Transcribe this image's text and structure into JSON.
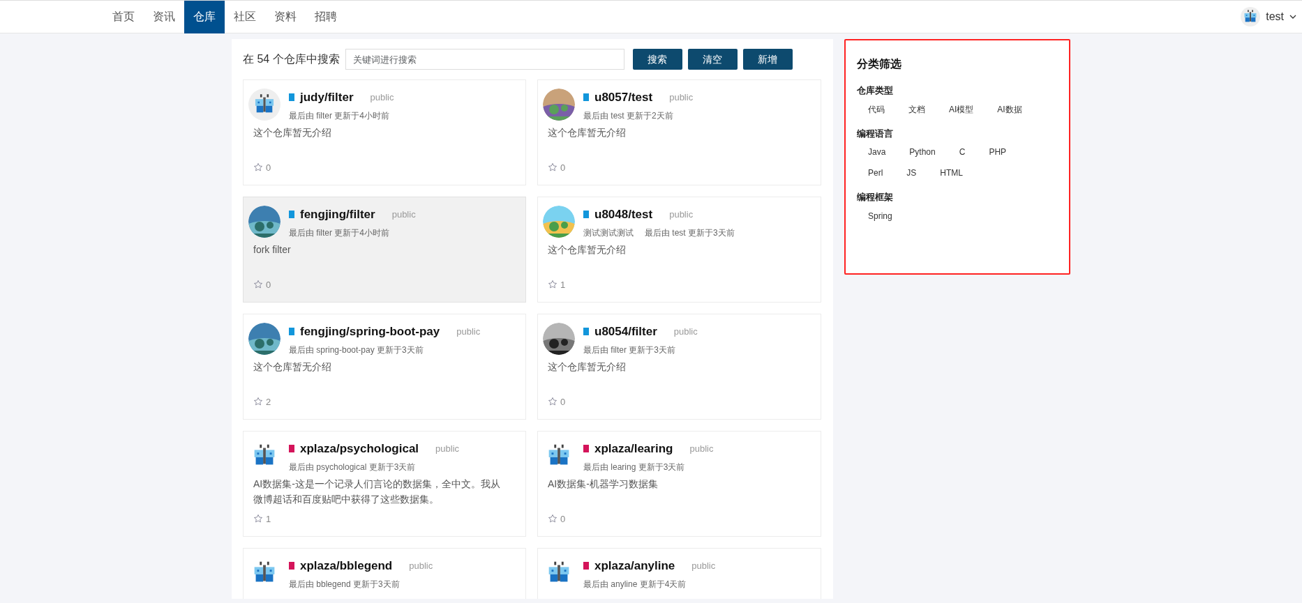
{
  "nav": {
    "items": [
      {
        "label": "首页",
        "selected": false
      },
      {
        "label": "资讯",
        "selected": false
      },
      {
        "label": "仓库",
        "selected": true
      },
      {
        "label": "社区",
        "selected": false
      },
      {
        "label": "资料",
        "selected": false
      },
      {
        "label": "招聘",
        "selected": false
      }
    ],
    "user": {
      "name": "test"
    }
  },
  "search": {
    "title": "在 54 个仓库中搜索",
    "placeholder": "关键词进行搜索",
    "buttons": [
      "搜索",
      "清空",
      "新增"
    ]
  },
  "repos": [
    {
      "kind": "butterfly",
      "color": "#1296db",
      "name": "judy/filter",
      "visibility": "public",
      "meta": "最后由 filter 更新于4小时前",
      "description": "这个仓库暂无介绍",
      "stars": "0",
      "hovered": false
    },
    {
      "kind": "picture",
      "color": "#1296db",
      "name": "u8057/test",
      "visibility": "public",
      "meta": "最后由 test 更新于2天前",
      "description": "这个仓库暂无介绍",
      "stars": "0",
      "hovered": false
    },
    {
      "kind": "picture",
      "color": "#1296db",
      "name": "fengjing/filter",
      "visibility": "public",
      "meta": "最后由 filter 更新于4小时前",
      "description": "fork filter",
      "stars": "0",
      "hovered": true
    },
    {
      "kind": "picture",
      "color": "#1296db",
      "name": "u8048/test",
      "visibility": "public",
      "tag": "测试测试测试",
      "meta": "最后由 test 更新于3天前",
      "description": "这个仓库暂无介绍",
      "stars": "1",
      "hovered": false
    },
    {
      "kind": "picture",
      "color": "#1296db",
      "name": "fengjing/spring-boot-pay",
      "visibility": "public",
      "meta": "最后由 spring-boot-pay 更新于3天前",
      "description": "这个仓库暂无介绍",
      "stars": "2",
      "hovered": false
    },
    {
      "kind": "picture",
      "color": "#1296db",
      "name": "u8054/filter",
      "visibility": "public",
      "meta": "最后由 filter 更新于3天前",
      "description": "这个仓库暂无介绍",
      "stars": "0",
      "hovered": false
    },
    {
      "kind": "butterfly",
      "color": "#d4145a",
      "name": "xplaza/psychological",
      "visibility": "public",
      "meta": "最后由 psychological 更新于3天前",
      "description": "AI数据集-这是一个记录人们言论的数据集，全中文。我从微博超话和百度贴吧中获得了这些数据集。",
      "stars": "1",
      "hovered": false
    },
    {
      "kind": "butterfly",
      "color": "#d4145a",
      "name": "xplaza/learing",
      "visibility": "public",
      "meta": "最后由 learing 更新于3天前",
      "description": "AI数据集-机器学习数据集",
      "stars": "0",
      "hovered": false
    },
    {
      "kind": "butterfly",
      "color": "#d4145a",
      "name": "xplaza/bblegend",
      "visibility": "public",
      "meta": "最后由 bblegend 更新于3天前",
      "hovered": false
    },
    {
      "kind": "butterfly",
      "color": "#d4145a",
      "name": "xplaza/anyline",
      "visibility": "public",
      "meta": "最后由 anyline 更新于4天前",
      "hovered": false
    }
  ],
  "filters": {
    "title": "分类筛选",
    "groups": [
      {
        "title": "仓库类型",
        "options": [
          "代码",
          "文档",
          "AI模型",
          "AI数据"
        ]
      },
      {
        "title": "编程语言",
        "options": [
          "Java",
          "Python",
          "C",
          "PHP",
          "Perl",
          "JS",
          "HTML"
        ]
      },
      {
        "title": "编程框架",
        "options": [
          "Spring"
        ]
      }
    ]
  }
}
